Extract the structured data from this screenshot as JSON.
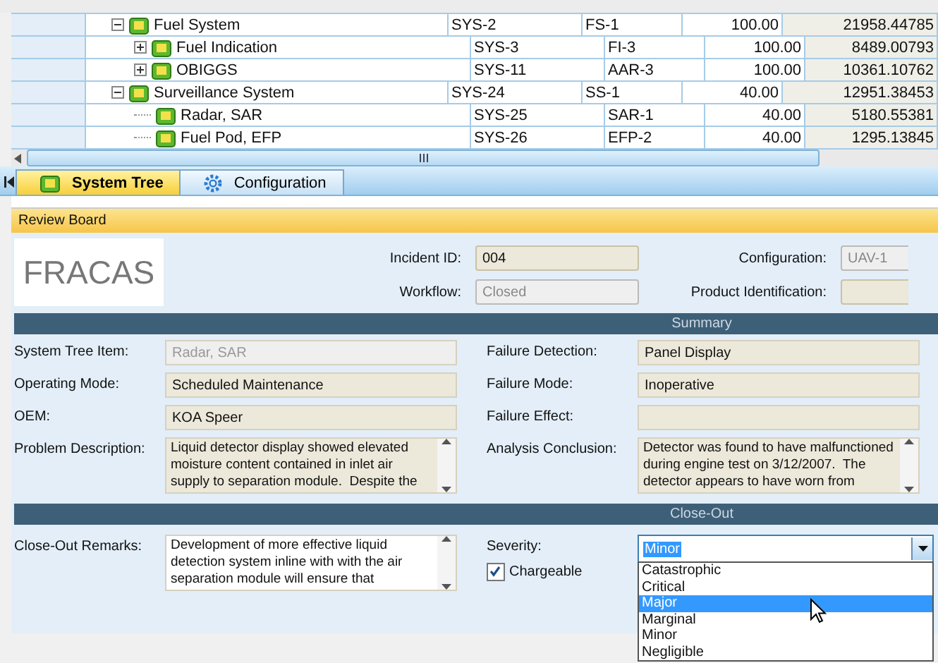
{
  "tree_grid": {
    "rows": [
      {
        "name": "Fuel System",
        "expanded": true,
        "cells": [
          "SYS-2",
          "FS-1",
          "100.00",
          "21958.44785"
        ],
        "children": [
          {
            "name": "Fuel Indication",
            "expanded": false,
            "cells": [
              "SYS-3",
              "FI-3",
              "100.00",
              "8489.00793"
            ]
          },
          {
            "name": "OBIGGS",
            "expanded": false,
            "cells": [
              "SYS-11",
              "AAR-3",
              "100.00",
              "10361.10762"
            ]
          }
        ]
      },
      {
        "name": "Surveillance System",
        "expanded": true,
        "cells": [
          "SYS-24",
          "SS-1",
          "40.00",
          "12951.38453"
        ],
        "children": [
          {
            "name": "Radar, SAR",
            "cells": [
              "SYS-25",
              "SAR-1",
              "40.00",
              "5180.55381"
            ]
          },
          {
            "name": "Fuel Pod, EFP",
            "cells": [
              "SYS-26",
              "EFP-2",
              "40.00",
              "1295.13845"
            ]
          }
        ]
      }
    ]
  },
  "tabs": [
    {
      "label": "System Tree",
      "selected": true
    },
    {
      "label": "Configuration",
      "selected": false
    }
  ],
  "review_board": {
    "title": "Review Board",
    "logo": "FRACAS",
    "header_fields": [
      {
        "label": "Incident ID:",
        "value": "004",
        "disabled": false
      },
      {
        "label": "Configuration:",
        "value": "UAV-1",
        "disabled": true
      },
      {
        "label": "Workflow:",
        "value": "Closed",
        "disabled": true
      },
      {
        "label": "Product Identification:",
        "disabled": false
      }
    ],
    "summary": {
      "title": "Summary",
      "fields": [
        {
          "label": "System Tree Item:",
          "value": "Radar, SAR",
          "disabled": true,
          "kind": "text"
        },
        {
          "label": "Failure Detection:",
          "value": "Panel Display",
          "disabled": false,
          "kind": "text"
        },
        {
          "label": "Operating Mode:",
          "value": "Scheduled Maintenance",
          "disabled": false,
          "kind": "text"
        },
        {
          "label": "Failure Mode:",
          "value": "Inoperative",
          "disabled": false,
          "kind": "text"
        },
        {
          "label": "OEM:",
          "value": "KOA Speer",
          "disabled": false,
          "kind": "text"
        },
        {
          "label": "Failure Effect:",
          "disabled": false,
          "kind": "text"
        },
        {
          "label": "Problem Description:",
          "value": "Liquid detector display showed elevated moisture content contained in inlet air supply to separation module.  Despite the",
          "disabled": false,
          "kind": "memo"
        },
        {
          "label": "Analysis Conclusion:",
          "value": "Detector was found to have malfunctioned during engine test on 3/12/2007.  The detector appears to have worn from",
          "disabled": false,
          "kind": "memo"
        }
      ]
    },
    "close_out": {
      "title": "Close-Out",
      "remarks": {
        "label": "Close-Out Remarks:",
        "value": "Development of more effective liquid detection system inline with with the air separation module will ensure that"
      },
      "severity": {
        "label": "Severity:",
        "value": "Minor",
        "expanded": true,
        "options": [
          {
            "label": "Catastrophic",
            "highlighted": false
          },
          {
            "label": "Critical",
            "highlighted": false
          },
          {
            "label": "Major",
            "highlighted": true
          },
          {
            "label": "Marginal",
            "highlighted": false
          },
          {
            "label": "Minor",
            "highlighted": false
          },
          {
            "label": "Negligible",
            "highlighted": false
          }
        ]
      },
      "chargeable": {
        "label": "Chargeable",
        "checked": true
      }
    }
  }
}
